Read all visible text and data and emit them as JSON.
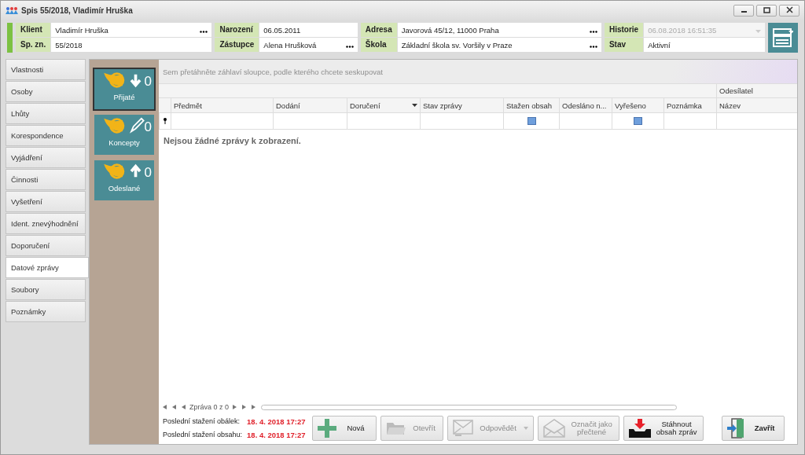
{
  "window": {
    "title": "Spis 55/2018, Vladimír Hruška"
  },
  "header": {
    "groups": [
      {
        "fields": [
          {
            "label": "Klient",
            "value": "Vladimír Hruška",
            "browse": true
          },
          {
            "label": "Sp. zn.",
            "value": "55/2018"
          }
        ]
      },
      {
        "fields": [
          {
            "label": "Narození",
            "value": "06.05.2011"
          },
          {
            "label": "Zástupce",
            "value": "Alena Hrušková",
            "browse": true
          }
        ]
      },
      {
        "fields": [
          {
            "label": "Adresa",
            "value": "Javorová 45/12, 11000 Praha",
            "browse": true
          },
          {
            "label": "Škola",
            "value": "Základní škola sv. Voršily v Praze",
            "browse": true
          }
        ]
      },
      {
        "fields": [
          {
            "label": "Historie",
            "value": "06.08.2018 16:51:35",
            "disabled": true,
            "dropdown": true
          },
          {
            "label": "Stav",
            "value": "Aktivní"
          }
        ]
      }
    ]
  },
  "sidebar": {
    "items": [
      {
        "label": "Vlastnosti",
        "selected": false
      },
      {
        "label": "Osoby",
        "selected": false
      },
      {
        "label": "Lhůty",
        "selected": false
      },
      {
        "label": "Korespondence",
        "selected": false
      },
      {
        "label": "Vyjádření",
        "selected": false
      },
      {
        "label": "Činnosti",
        "selected": false
      },
      {
        "label": "Vyšetření",
        "selected": false
      },
      {
        "label": "Ident. znevýhodnění",
        "selected": false
      },
      {
        "label": "Doporučení",
        "selected": false
      },
      {
        "label": "Datové zprávy",
        "selected": true
      },
      {
        "label": "Soubory",
        "selected": false
      },
      {
        "label": "Poznámky",
        "selected": false
      }
    ]
  },
  "folders": [
    {
      "kind": "received",
      "label": "Přijaté",
      "count": "0",
      "selected": true
    },
    {
      "kind": "draft",
      "label": "Koncepty",
      "count": "0",
      "selected": false
    },
    {
      "kind": "sent",
      "label": "Odeslané",
      "count": "0",
      "selected": false
    }
  ],
  "grid": {
    "group_hint": "Sem přetáhněte záhlaví sloupce, podle kterého chcete seskupovat",
    "band": "Odesílatel",
    "columns": [
      {
        "label": "Předmět",
        "kind": "text",
        "sorted": false
      },
      {
        "label": "Dodání",
        "kind": "text",
        "sorted": false
      },
      {
        "label": "Doručení",
        "kind": "text",
        "sorted": true
      },
      {
        "label": "Stav zprávy",
        "kind": "text",
        "sorted": false
      },
      {
        "label": "Stažen obsah",
        "kind": "checkbox",
        "sorted": false
      },
      {
        "label": "Odesláno n...",
        "kind": "text",
        "sorted": false
      },
      {
        "label": "Vyřešeno",
        "kind": "checkbox",
        "sorted": false
      },
      {
        "label": "Poznámka",
        "kind": "text",
        "sorted": false
      },
      {
        "label": "Název",
        "kind": "text",
        "sorted": false
      }
    ],
    "empty_text": "Nejsou žádné zprávy k zobrazení.",
    "pager": "Zpráva 0 z 0"
  },
  "status": [
    {
      "label": "Poslední stažení obálek:",
      "value": "18. 4. 2018 17:27"
    },
    {
      "label": "Poslední stažení obsahu:",
      "value": "18. 4. 2018 17:27"
    }
  ],
  "buttons": [
    {
      "kind": "new",
      "label": "Nová",
      "disabled": false
    },
    {
      "kind": "open",
      "label": "Otevřít",
      "disabled": true
    },
    {
      "kind": "reply",
      "label": "Odpovědět",
      "disabled": true
    },
    {
      "kind": "mark_read",
      "label": "Označit jako přečtené",
      "disabled": true
    },
    {
      "kind": "download",
      "label": "Stáhnout obsah zpráv",
      "disabled": false
    },
    {
      "kind": "close",
      "label": "Zavřít",
      "disabled": false
    }
  ]
}
